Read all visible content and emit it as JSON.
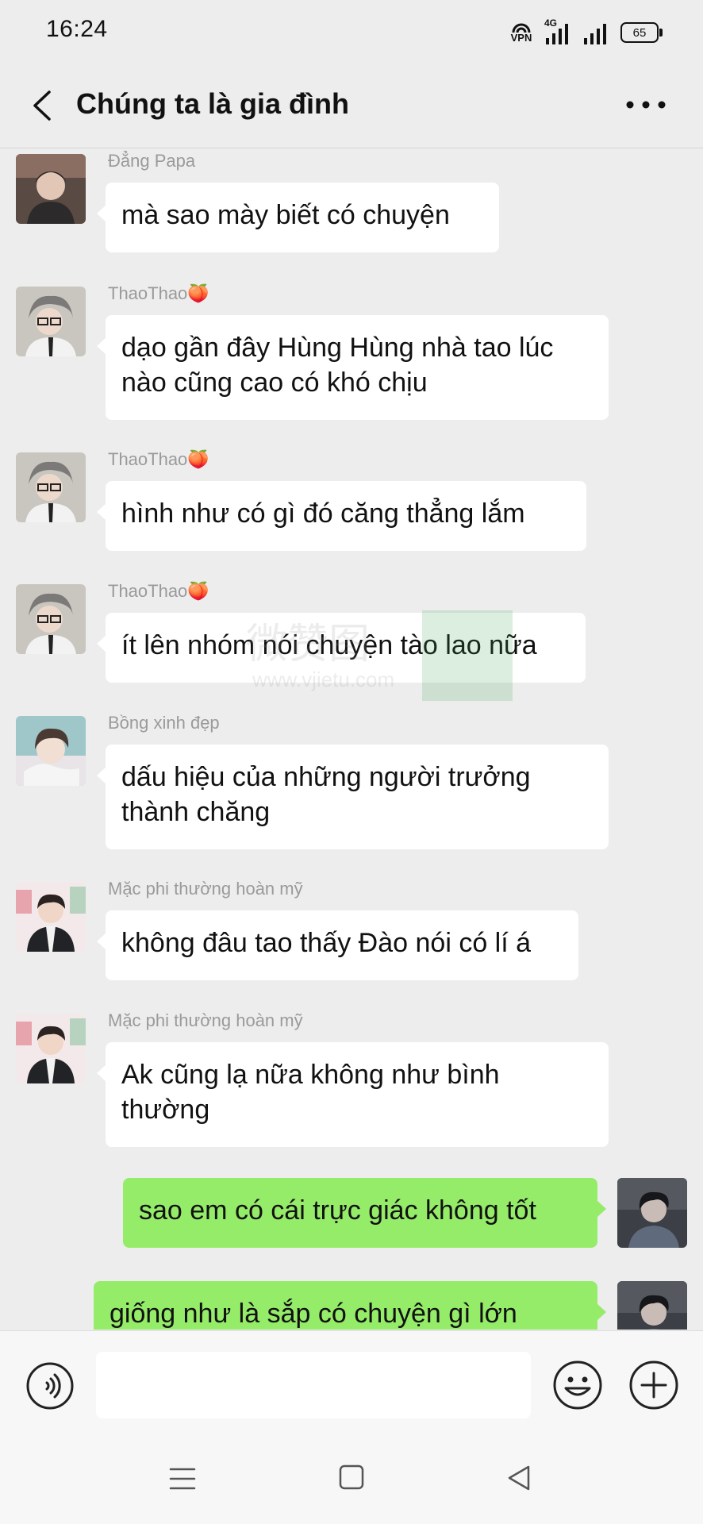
{
  "status_bar": {
    "time": "16:24",
    "vpn_label": "VPN",
    "network": "4G",
    "battery": "65"
  },
  "header": {
    "title": "Chúng ta là gia đình",
    "back_icon": "chevron-left-icon",
    "more_icon": "more-dots-icon"
  },
  "messages": [
    {
      "sender": "Đẳng Papa",
      "text": "mà sao mày biết có chuyện"
    },
    {
      "sender": "ThaoThao🍑",
      "text": "dạo gần đây Hùng Hùng nhà tao lúc nào cũng cao có khó chịu"
    },
    {
      "sender": "ThaoThao🍑",
      "text": "hình như có gì đó căng thẳng lắm"
    },
    {
      "sender": "ThaoThao🍑",
      "text": "ít lên nhóm nói chuyện tào lao nữa"
    },
    {
      "sender": "Bồng xinh đẹp",
      "text": "dấu hiệu của những người trưởng thành chăng"
    },
    {
      "sender": "Mặc phi thường hoàn mỹ",
      "text": "không đâu tao thấy Đào nói có lí á"
    },
    {
      "sender": "Mặc phi thường hoàn mỹ",
      "text": "Ak cũng lạ nữa không như bình thường"
    },
    {
      "sender": "",
      "text": "sao em có cái trực giác không tốt"
    },
    {
      "sender": "",
      "text": "giống như là sắp có chuyện gì lớn"
    }
  ],
  "watermark": {
    "text_cn": "微赞图",
    "url": "www.vjietu.com"
  },
  "input": {
    "value": "",
    "placeholder": ""
  },
  "colors": {
    "background": "#ededed",
    "bubble_self": "#95ec69",
    "bubble_other": "#ffffff",
    "sender_text": "#9a9a9a"
  },
  "icons": {
    "voice": "voice-icon",
    "emoji": "emoji-icon",
    "plus": "plus-icon"
  }
}
